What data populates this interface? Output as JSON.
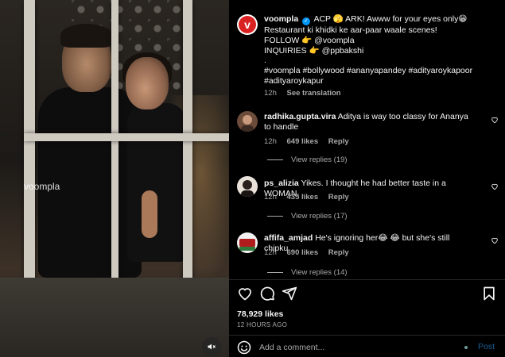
{
  "media": {
    "watermark": "voompla",
    "mute_icon": "speaker-muted-icon"
  },
  "post": {
    "author": "voompla",
    "caption_prefix": "ACP 🫣 ARK! Awww for your eyes only😁 Restaurant ki khidki ke aar-paar waale scenes!",
    "caption_follow": "FOLLOW 👉 @voompla",
    "caption_inquiries": "INQUIRIES 👉 @ppbakshi",
    "caption_dot": ".",
    "hashtags": "#voompla #bollywood #ananyapandey #adityaroykapoor #adityaroykapur",
    "time": "12h",
    "see_translation": "See translation"
  },
  "comments": [
    {
      "username": "radhika.gupta.vira",
      "text": "Aditya is way too classy for Ananya to handle",
      "time": "12h",
      "likes": "649 likes",
      "reply": "Reply",
      "view_replies": "View replies (19)"
    },
    {
      "username": "ps_alizia",
      "text": "Yikes. I thought he had better taste in a WOMAN. .",
      "time": "12h",
      "likes": "435 likes",
      "reply": "Reply",
      "view_replies": "View replies (17)"
    },
    {
      "username": "affifa_amjad",
      "text": "He's ignoring her😂 😂 but she's still chipku",
      "time": "12h",
      "likes": "690 likes",
      "reply": "Reply",
      "view_replies": "View replies (14)"
    }
  ],
  "actions": {
    "like_icon": "heart-icon",
    "comment_icon": "comment-icon",
    "share_icon": "send-icon",
    "save_icon": "bookmark-icon"
  },
  "stats": {
    "likes": "78,929 likes",
    "date": "12 HOURS AGO"
  },
  "composer": {
    "placeholder": "Add a comment...",
    "post_label": "Post"
  },
  "colors": {
    "background": "#000000",
    "muted_text": "#a8a8a8",
    "verified": "#0095f6",
    "brand_red": "#d92121",
    "post_disabled": "#1a5f94"
  }
}
